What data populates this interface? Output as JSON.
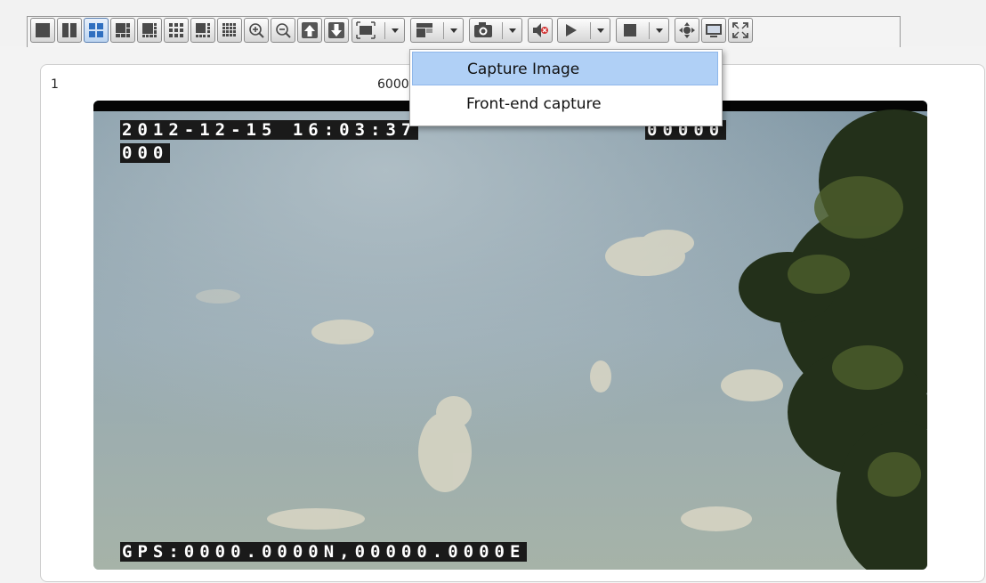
{
  "toolbar": {
    "buttons": [
      {
        "name": "layout-1-icon",
        "interactable": true
      },
      {
        "name": "layout-2-icon",
        "interactable": true
      },
      {
        "name": "layout-4-icon",
        "interactable": true
      },
      {
        "name": "layout-6-icon",
        "interactable": true
      },
      {
        "name": "layout-8-icon",
        "interactable": true
      },
      {
        "name": "layout-9-icon",
        "interactable": true
      },
      {
        "name": "layout-10-icon",
        "interactable": true
      },
      {
        "name": "layout-16-icon",
        "interactable": true
      },
      {
        "name": "zoom-in-icon",
        "interactable": true
      },
      {
        "name": "zoom-out-icon",
        "interactable": true
      },
      {
        "name": "page-up-icon",
        "interactable": true
      },
      {
        "name": "page-down-icon",
        "interactable": true
      }
    ],
    "selected_layout": "layout-4-icon",
    "split_buttons": [
      {
        "name": "fit-window-icon"
      },
      {
        "name": "window-mode-icon"
      },
      {
        "name": "capture-camera-icon"
      }
    ],
    "audio_icon": "speaker-mute-icon",
    "play_split": "play-icon",
    "stop_split": "stop-icon",
    "extra": [
      {
        "name": "ptz-icon"
      },
      {
        "name": "monitor-icon"
      },
      {
        "name": "fullscreen-icon"
      }
    ]
  },
  "panel": {
    "index": "1",
    "title": "6000"
  },
  "video": {
    "osd_datetime": "2012-12-15 16:03:37",
    "osd_speed": "00000",
    "osd_line2": "000",
    "osd_gps": "GPS:0000.0000N,00000.0000E"
  },
  "capture_menu": {
    "items": [
      {
        "label": "Capture Image",
        "highlighted": true
      },
      {
        "label": "Front-end capture",
        "highlighted": false
      }
    ]
  },
  "colors": {
    "accent": "#b0d0f6",
    "selected_button": "#3a78c8",
    "panel_bg": "#ffffff"
  }
}
